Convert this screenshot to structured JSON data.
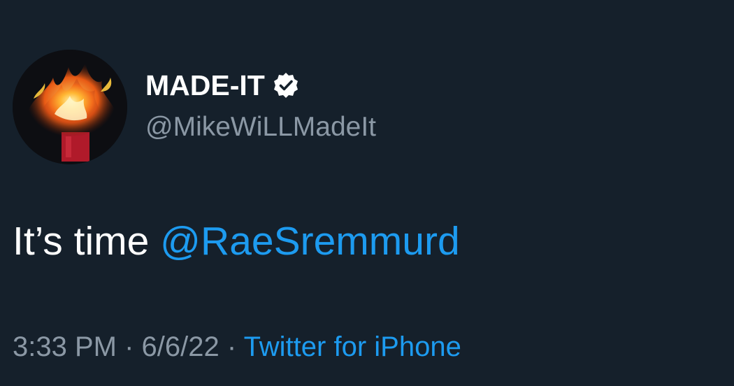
{
  "tweet": {
    "display_name": "MADE-IT",
    "handle": "@MikeWiLLMadeIt",
    "verified_icon": "verified-badge-icon",
    "avatar_icon": "flaming-sculpture-avatar",
    "text_prefix": "It’s time ",
    "mention": "@RaeSremmurd",
    "time": "3:33 PM",
    "separator": " · ",
    "date": "6/6/22",
    "source": "Twitter for iPhone"
  },
  "colors": {
    "background": "#15202b",
    "primary_text": "#ffffff",
    "secondary_text": "#8b98a5",
    "accent": "#1d9bf0"
  }
}
